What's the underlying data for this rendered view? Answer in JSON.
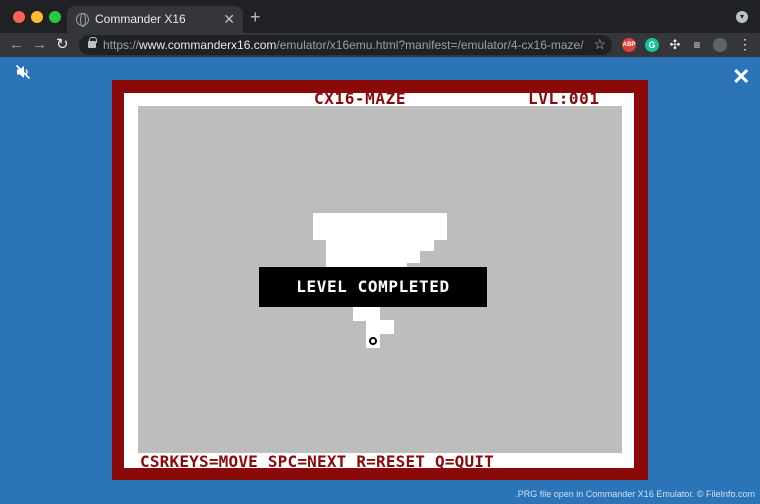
{
  "browser": {
    "tab_title": "Commander X16",
    "tab_close": "✕",
    "new_tab": "+",
    "url_scheme": "https://",
    "url_host": "www.commanderx16.com",
    "url_path": "/emulator/x16emu.html?manifest=/emulator/4-cx16-maze/",
    "back_icon": "arrow-left-icon",
    "forward_icon": "arrow-right-icon",
    "reload_icon": "reload-icon",
    "extensions": [
      "ABP",
      "G"
    ]
  },
  "page": {
    "mute_icon": "speaker-muted-icon",
    "close_label": "✕"
  },
  "game": {
    "title": "CX16-MAZE",
    "level": "LVL:001",
    "banner": "LEVEL COMPLETED",
    "help": "CSRKEYS=MOVE SPC=NEXT R=RESET Q=QUIT",
    "colors": {
      "border": "#8a0a0a",
      "frame": "#ffffff",
      "floor": "#bdbdbd",
      "banner": "#000000",
      "page": "#2b74b8"
    }
  },
  "footer": {
    "note": ".PRG file open in Commander X16 Emulator. © FileInfo.com"
  }
}
